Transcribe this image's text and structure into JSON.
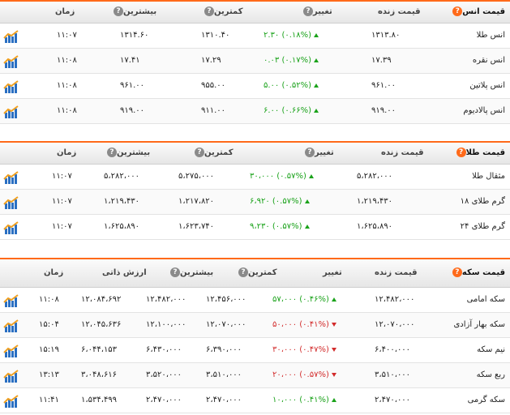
{
  "sections": [
    {
      "id": "ounce",
      "title": "قیمت انس",
      "headers": {
        "price": "قیمت زنده",
        "change": "تغییر",
        "low": "کمترین",
        "high": "بیشترین",
        "time": "زمان"
      },
      "rows": [
        {
          "name": "انس طلا",
          "price": "۱۳۱۳.۸۰",
          "change": "۲.۳۰ (۰.۱۸%)",
          "dir": "up",
          "low": "۱۳۱۰.۴۰",
          "high": "۱۳۱۴.۶۰",
          "time": "۱۱:۰۷"
        },
        {
          "name": "انس نقره",
          "price": "۱۷.۳۹",
          "change": "۰.۰۳ (۰.۱۷%)",
          "dir": "up",
          "low": "۱۷.۲۹",
          "high": "۱۷.۴۱",
          "time": "۱۱:۰۸"
        },
        {
          "name": "انس پلاتین",
          "price": "۹۶۱.۰۰",
          "change": "۵.۰۰ (۰.۵۲%)",
          "dir": "up",
          "low": "۹۵۵.۰۰",
          "high": "۹۶۱.۰۰",
          "time": "۱۱:۰۸"
        },
        {
          "name": "انس پالادیوم",
          "price": "۹۱۹.۰۰",
          "change": "۶.۰۰ (۰.۶۶%)",
          "dir": "up",
          "low": "۹۱۱.۰۰",
          "high": "۹۱۹.۰۰",
          "time": "۱۱:۰۸"
        }
      ]
    },
    {
      "id": "gold",
      "title": "قیمت طلا",
      "headers": {
        "price": "قیمت زنده",
        "change": "تغییر",
        "low": "کمترین",
        "high": "بیشترین",
        "time": "زمان"
      },
      "rows": [
        {
          "name": "مثقال طلا",
          "price": "۵،۲۸۲،۰۰۰",
          "change": "۳۰،۰۰۰ (۰.۵۷%)",
          "dir": "up",
          "low": "۵،۲۷۵،۰۰۰",
          "high": "۵،۲۸۲،۰۰۰",
          "time": "۱۱:۰۷"
        },
        {
          "name": "گرم طلای ۱۸",
          "price": "۱،۲۱۹،۴۳۰",
          "change": "۶،۹۲۰ (۰.۵۷%)",
          "dir": "up",
          "low": "۱،۲۱۷،۸۲۰",
          "high": "۱،۲۱۹،۴۳۰",
          "time": "۱۱:۰۷"
        },
        {
          "name": "گرم طلای ۲۴",
          "price": "۱،۶۲۵،۸۹۰",
          "change": "۹،۲۳۰ (۰.۵۷%)",
          "dir": "up",
          "low": "۱،۶۲۳،۷۴۰",
          "high": "۱،۶۲۵،۸۹۰",
          "time": "۱۱:۰۷"
        }
      ]
    },
    {
      "id": "coin",
      "title": "قیمت سکه",
      "headers": {
        "price": "قیمت زنده",
        "change": "تغییر",
        "low": "کمترین",
        "high": "بیشترین",
        "intrinsic": "ارزش ذاتی",
        "time": "زمان"
      },
      "rows": [
        {
          "name": "سکه امامی",
          "price": "۱۲،۴۸۲،۰۰۰",
          "change": "۵۷،۰۰۰ (۰.۴۶%)",
          "dir": "up",
          "low": "۱۲،۴۵۶،۰۰۰",
          "high": "۱۲،۴۸۲،۰۰۰",
          "intrinsic": "۱۲،۰۸۴،۶۹۲",
          "time": "۱۱:۰۸"
        },
        {
          "name": "سکه بهار آزادی",
          "price": "۱۲،۰۷۰،۰۰۰",
          "change": "۵۰،۰۰۰ (۰.۴۱%)",
          "dir": "down",
          "low": "۱۲،۰۷۰،۰۰۰",
          "high": "۱۲،۱۰۰،۰۰۰",
          "intrinsic": "۱۲،۰۴۵،۶۳۶",
          "time": "۱۵:۰۴"
        },
        {
          "name": "نیم سکه",
          "price": "۶،۴۰۰،۰۰۰",
          "change": "۳۰،۰۰۰ (۰.۴۷%)",
          "dir": "down",
          "low": "۶،۳۹۰،۰۰۰",
          "high": "۶،۴۳۰،۰۰۰",
          "intrinsic": "۶،۰۴۴،۱۵۳",
          "time": "۱۵:۱۹"
        },
        {
          "name": "ربع سکه",
          "price": "۳،۵۱۰،۰۰۰",
          "change": "۲۰،۰۰۰ (۰.۵۷%)",
          "dir": "down",
          "low": "۳،۵۱۰،۰۰۰",
          "high": "۳،۵۲۰،۰۰۰",
          "intrinsic": "۳،۰۴۸،۶۱۶",
          "time": "۱۳:۱۳"
        },
        {
          "name": "سکه گرمی",
          "price": "۲،۴۷۰،۰۰۰",
          "change": "۱۰،۰۰۰ (۰.۴۱%)",
          "dir": "up",
          "low": "۲،۴۷۰،۰۰۰",
          "high": "۲،۴۷۰،۰۰۰",
          "intrinsic": "۱،۵۳۴،۴۹۹",
          "time": "۱۱:۴۱"
        }
      ]
    }
  ],
  "colors": {
    "accent": "#ff6a1a",
    "positive": "#1aa21a",
    "negative": "#d22b2b",
    "chart_icon_blue": "#2a6fc2",
    "chart_icon_gold": "#f0a020"
  },
  "icons": {
    "title": "question-circle-icon",
    "help": "question-circle-icon",
    "row_action": "chart-icon"
  }
}
